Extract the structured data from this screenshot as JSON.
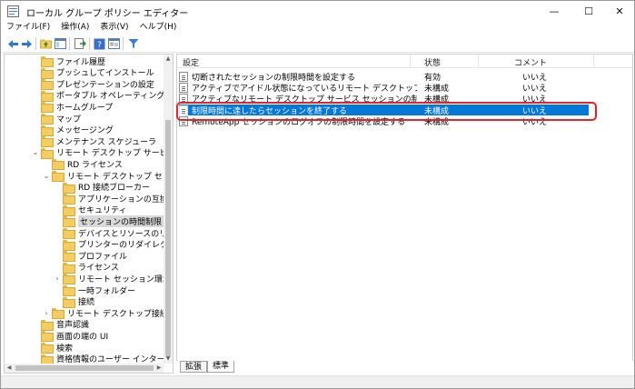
{
  "window": {
    "title": "ローカル グループ ポリシー エディター",
    "minimize": "—",
    "maximize": "☐",
    "close": "✕"
  },
  "menu": [
    "ファイル(F)",
    "操作(A)",
    "表示(V)",
    "ヘルプ(H)"
  ],
  "toolbar_icons": [
    "back-arrow-icon",
    "forward-arrow-icon",
    "folder-up-icon",
    "show-hide-tree-icon",
    "export-list-icon",
    "help-icon",
    "properties-icon",
    "filter-icon"
  ],
  "tree": [
    {
      "label": "ファイル履歴",
      "indent": 3
    },
    {
      "label": "プッシュしてインストール",
      "indent": 3
    },
    {
      "label": "プレゼンテーションの設定",
      "indent": 3
    },
    {
      "label": "ポータブル オペレーティング システ",
      "indent": 3
    },
    {
      "label": "ホームグループ",
      "indent": 3
    },
    {
      "label": "マップ",
      "indent": 3
    },
    {
      "label": "メッセージング",
      "indent": 3
    },
    {
      "label": "メンテナンス スケジューラ",
      "indent": 3
    },
    {
      "label": "リモート デスクトップ サービス",
      "indent": 3,
      "expanded": true
    },
    {
      "label": "RD ライセンス",
      "indent": 4
    },
    {
      "label": "リモート デスクトップ セッション",
      "indent": 4,
      "expanded": true
    },
    {
      "label": "RD 接続ブローカー",
      "indent": 5
    },
    {
      "label": "アプリケーションの互換性",
      "indent": 5
    },
    {
      "label": "セキュリティ",
      "indent": 5
    },
    {
      "label": "セッションの時間制限",
      "indent": 5,
      "selected": true
    },
    {
      "label": "デバイスとリソースのリダイ",
      "indent": 5
    },
    {
      "label": "プリンターのリダイレクト",
      "indent": 5
    },
    {
      "label": "プロファイル",
      "indent": 5
    },
    {
      "label": "ライセンス",
      "indent": 5
    },
    {
      "label": "リモート セッション環境",
      "indent": 5,
      "collapsed": true
    },
    {
      "label": "一時フォルダー",
      "indent": 5
    },
    {
      "label": "接続",
      "indent": 5
    },
    {
      "label": "リモート デスクトップ接続のク",
      "indent": 4,
      "collapsed": true
    },
    {
      "label": "音声認識",
      "indent": 3
    },
    {
      "label": "画面の端の UI",
      "indent": 3
    },
    {
      "label": "検索",
      "indent": 3
    },
    {
      "label": "資格情報のユーザー インターフェイ",
      "indent": 3
    }
  ],
  "list": {
    "columns": {
      "setting": "設定",
      "state": "状態",
      "comment": "コメント"
    },
    "rows": [
      {
        "name": "切断されたセッションの制限時間を設定する",
        "state": "有効",
        "comment": "いいえ"
      },
      {
        "name": "アクティブでアイドル状態になっているリモート デスクトップ サービス セッ...",
        "state": "未構成",
        "comment": "いいえ"
      },
      {
        "name": "アクティブなリモート デスクトップ サービス セッションの制限時間を設定...",
        "state": "未構成",
        "comment": "いいえ"
      },
      {
        "name": "制限時間に達したらセッションを終了する",
        "state": "未構成",
        "comment": "いいえ",
        "selected": true
      },
      {
        "name": "RemoteApp セッションのログオフの制限時間を設定する",
        "state": "未構成",
        "comment": "いいえ"
      }
    ]
  },
  "tabs": [
    "拡張",
    "標準"
  ],
  "colors": {
    "selection": "#0078d7",
    "highlight_box": "#e0252b",
    "folder": "#f3cd62"
  }
}
